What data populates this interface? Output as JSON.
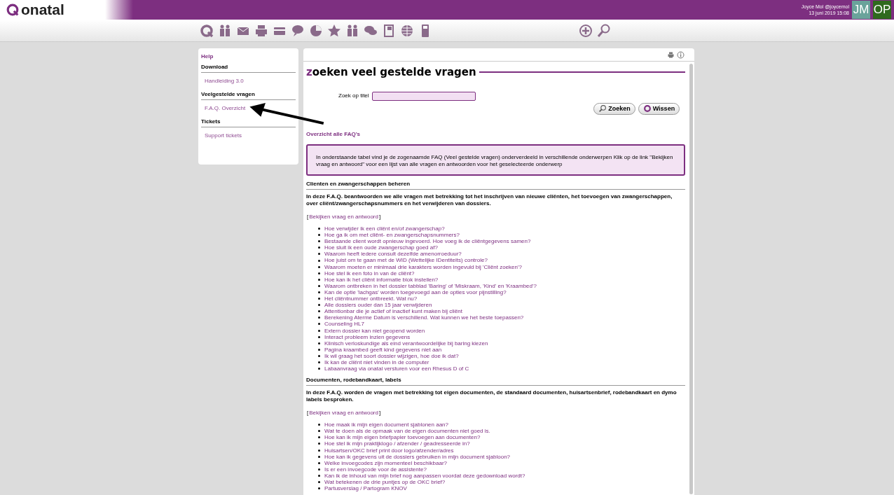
{
  "header": {
    "logo": "onatal",
    "user": "Joyce Mol @joycemol",
    "datetime": "13 juni 2019 15:08",
    "avatars": [
      {
        "initials": "JM",
        "color": "#6aa39b"
      },
      {
        "initials": "OP",
        "color": "#2f6a1e"
      }
    ]
  },
  "sidebar": {
    "title": "Help",
    "sections": [
      {
        "heading": "Download",
        "items": [
          {
            "label": "Handleiding 3.0"
          }
        ]
      },
      {
        "heading": "Veelgestelde vragen",
        "items": [
          {
            "label": "F.A.Q. Overzicht"
          }
        ]
      },
      {
        "heading": "Tickets",
        "items": [
          {
            "label": "Support tickets"
          }
        ]
      }
    ]
  },
  "main": {
    "title_first": "z",
    "title_rest": "oeken veel gestelde vragen",
    "search_label": "Zoek op titel",
    "buttons": [
      "Zoeken",
      "Wissen"
    ],
    "overview_title": "Overzicht alle FAQ's",
    "info": "In onderstaande tabel vind je de zogenaamde FAQ (Veel gestelde vragen) onderverdeeld in verschillende onderwerpen Klik op de link \"Bekijken vraag en antwoord\" voor een lijst van alle vragen en antwoorden voor het geselecteerde onderwerp",
    "topics": [
      {
        "heading": "Clienten en zwangerschappen beheren",
        "description": "In deze F.A.Q. beantwoorden we alle vragen met betrekking tot het inschrijven van nieuwe cliënten, het toevoegen van zwangerschappen, over cliënt/zwangerschapsnummers en het verwijderen van dossiers.",
        "open_bracket": "[",
        "link": "Bekijken vraag en antwoord",
        "close_bracket": "]",
        "questions": [
          "Hoe verwijder ik een cliënt en/of zwangerschap?",
          "Hoe ga ik om met cliënt- en zwangerschapsnummers?",
          "Bestaande client wordt opnieuw ingevoerd. Hoe voeg ik de cliëntgegevens samen?",
          "Hoe sluit ik een oude zwangerschap goed af?",
          "Waarom heeft iedere consult dezelfde amenorroeduur?",
          "Hoe juist om te gaan met de WID (Wettelijke IDentiteits) controle?",
          "Waarom moeten er minimaal drie karakters worden ingevuld bij 'Cliënt zoeken'?",
          "Hoe stel ik een foto in van de cliënt?",
          "Hoe kan ik het cliënt informatie blok instellen?",
          "Waarom ontbreken in het dossier tabblad 'Baring' of 'Miskraam, 'Kind' en 'Kraambed'?",
          "Kan de optie 'lachgas' worden toegevoegd aan de opties voor pijnstilling?",
          "Het cliëntnummer ontbreekt. Wat nu?",
          "Alle dossiers ouder dan 15 jaar verwijderen",
          "Attentionbar die je actief of inactief kunt maken bij cliënt",
          "Berekening Aterme Datum is verschillend. Wat kunnen we het beste toepassen?",
          "Counseling HL7",
          "Extern dossier kan niet geopend worden",
          "Interact probleem inzien gegevens",
          "Klinisch verloskundige als eind verantwoordelijke bij baring kiezen",
          "Pagina kraambed geeft kind gegevens niet aan",
          "Ik wil graag het soort dossier wijzigen, hoe doe ik dat?",
          "Ik kan de cliënt niet vinden in de computer",
          "Labaanvraag via onatal versturen voor een Rhesus D of C"
        ]
      },
      {
        "heading": "Documenten, rodebandkaart, labels",
        "description": "In deze F.A.Q. worden de vragen met betrekking tot eigen documenten, de standaard documenten, huisartsenbrief, rodebandkaart en dymo labels besproken.",
        "open_bracket": "[",
        "link": "Bekijken vraag en antwoord",
        "close_bracket": "]",
        "questions": [
          "Hoe maak ik mijn eigen document sjablonen aan?",
          "Wat te doen als de opmaak van de eigen documenten niet goed is.",
          "Hoe kan ik mijn eigen briefpapier toevoegen aan documenten?",
          "Hoe stel ik mijn praktijklogo / afzender / geadresseerde in?",
          "Huisartsen/OKC brief print door logo/afzender/adres",
          "Hoe kan ik gegevens uit de dossiers gebruiken in mijn document sjabloon?",
          "Welke invoegcodes zijn momenteel beschikbaar?",
          "Is er een invoegcode voor de assistente?",
          "Kan ik de inhoud van mijn brief nog aanpassen voordat deze gedownload wordt?",
          "Wat betekenen de drie puntjes op de OKC brief?",
          "Partusverslag / Partogram KNOV"
        ]
      }
    ]
  }
}
